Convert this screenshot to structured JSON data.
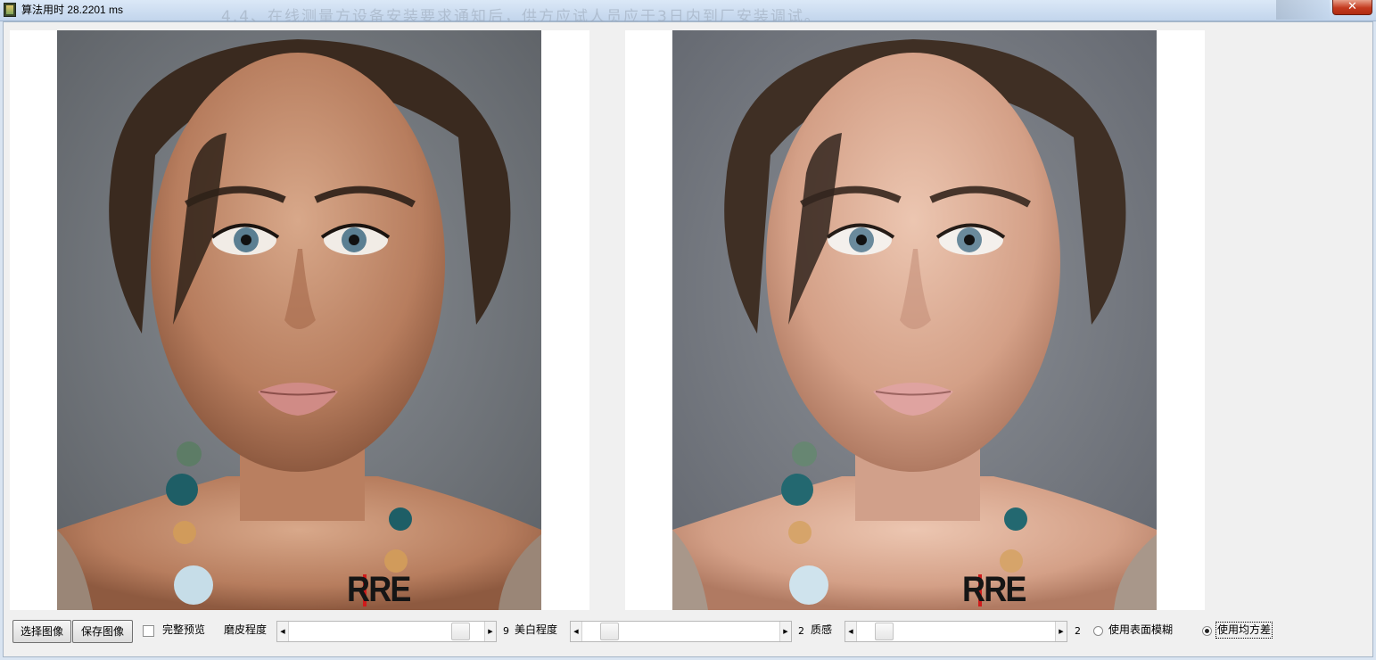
{
  "window": {
    "title": "算法用时 28.2201 ms",
    "background_text": "4.4、在线测量方设备安装要求通知后，供方应试人员应于3日内到厂安装调试。",
    "close_glyph": "✕"
  },
  "images": {
    "left": {
      "name": "original",
      "watermark": "RRE"
    },
    "right": {
      "name": "processed",
      "watermark": "RRE"
    }
  },
  "toolbar": {
    "select_image": "选择图像",
    "save_image": "保存图像",
    "full_preview_label": "完整预览",
    "full_preview_checked": false,
    "smoothing_label": "磨皮程度",
    "smoothing_value": "9",
    "smoothing_level": 0.92,
    "whitening_label": "美白程度",
    "whitening_value": "2",
    "whitening_level": 0.1,
    "quality_label": "质感",
    "quality_value": "2",
    "quality_level": 0.1,
    "surface_blur_label": "使用表面模糊",
    "surface_blur_selected": false,
    "mean_variance_label": "使用均方差",
    "mean_variance_selected": true
  },
  "colors": {
    "titlebar": "#c2d5ec",
    "close_button": "#c43a1f",
    "client_background": "#f0f0f0"
  }
}
